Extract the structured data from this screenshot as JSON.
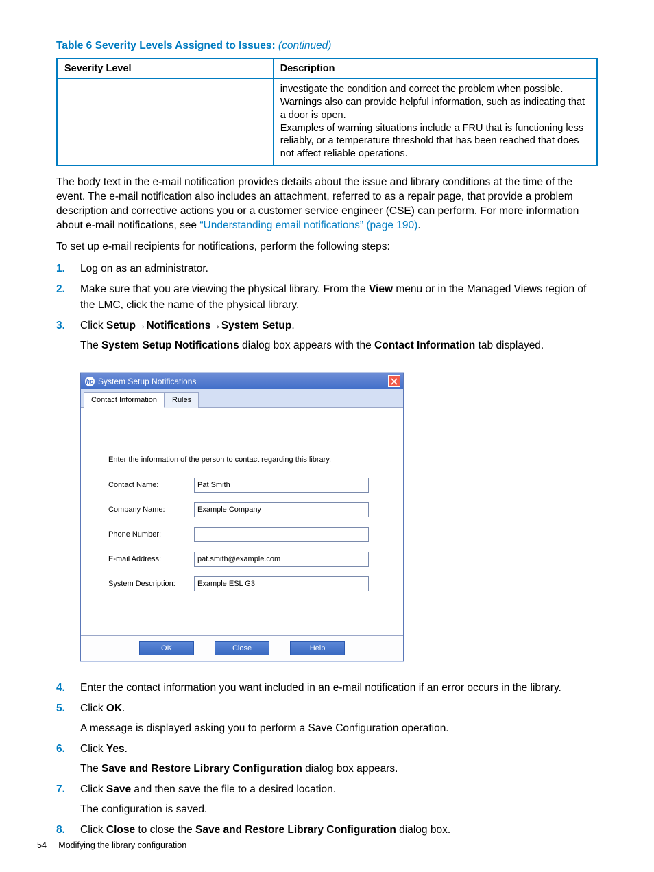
{
  "tableTitle": {
    "prefix": "Table 6 Severity Levels Assigned to Issues:  ",
    "suffix": "(continued)"
  },
  "table": {
    "headers": {
      "severity": "Severity Level",
      "description": "Description"
    },
    "row": {
      "severity": "",
      "description": "investigate the condition and correct the problem when possible. Warnings also can provide helpful information, such as indicating that a door is open.\nExamples of warning situations include a FRU that is functioning less reliably, or a temperature threshold that has been reached that does not affect reliable operations."
    }
  },
  "para1_a": "The body text in the e-mail notification provides details about the issue and library conditions at the time of the event. The e-mail notification also includes an attachment, referred to as a repair page, that provide a problem description and corrective actions you or a customer service engineer (CSE) can perform. For more information about e-mail notifications, see ",
  "para1_link": "“Understanding email notifications” (page 190)",
  "para1_b": ".",
  "para2": "To set up e-mail recipients for notifications, perform the following steps:",
  "steps_top": {
    "s1": "Log on as an administrator.",
    "s2_a": "Make sure that you are viewing the physical library. From the ",
    "s2_bold": "View",
    "s2_b": " menu or in the Managed Views region of the LMC, click the name of the physical library.",
    "s3_a": "Click ",
    "s3_b1": "Setup",
    "s3_arrow1": "→",
    "s3_b2": "Notifications",
    "s3_arrow2": "→",
    "s3_b3": "System Setup",
    "s3_dot": ".",
    "s3_line2_a": "The ",
    "s3_line2_b": "System Setup Notifications",
    "s3_line2_c": " dialog box appears with the ",
    "s3_line2_d": "Contact Information",
    "s3_line2_e": " tab displayed."
  },
  "dialog": {
    "title": "System Setup Notifications",
    "tabs": {
      "contact": "Contact Information",
      "rules": "Rules"
    },
    "instruction": "Enter the information of the person to contact regarding this library.",
    "fields": {
      "contactName": {
        "label": "Contact Name:",
        "value": "Pat Smith"
      },
      "companyName": {
        "label": "Company Name:",
        "value": "Example Company"
      },
      "phoneNumber": {
        "label": "Phone Number:",
        "value": ""
      },
      "email": {
        "label": "E-mail Address:",
        "value": "pat.smith@example.com"
      },
      "sysdesc": {
        "label": "System Description:",
        "value": "Example ESL G3"
      }
    },
    "buttons": {
      "ok": "OK",
      "close": "Close",
      "help": "Help"
    }
  },
  "steps_bottom": {
    "s4": "Enter the contact information you want included in an e-mail notification if an error occurs in the library.",
    "s5_a": "Click ",
    "s5_b": "OK",
    "s5_c": ".",
    "s5_line2": "A message is displayed asking you to perform a Save Configuration operation.",
    "s6_a": "Click ",
    "s6_b": "Yes",
    "s6_c": ".",
    "s6_line2_a": "The ",
    "s6_line2_b": "Save and Restore Library Configuration",
    "s6_line2_c": " dialog box appears.",
    "s7_a": "Click ",
    "s7_b": "Save",
    "s7_c": " and then save the file to a desired location.",
    "s7_line2": "The configuration is saved.",
    "s8_a": "Click ",
    "s8_b": "Close",
    "s8_c": " to close the ",
    "s8_d": "Save and Restore Library Configuration",
    "s8_e": " dialog box."
  },
  "footer": {
    "pagenum": "54",
    "section": "Modifying the library configuration"
  }
}
